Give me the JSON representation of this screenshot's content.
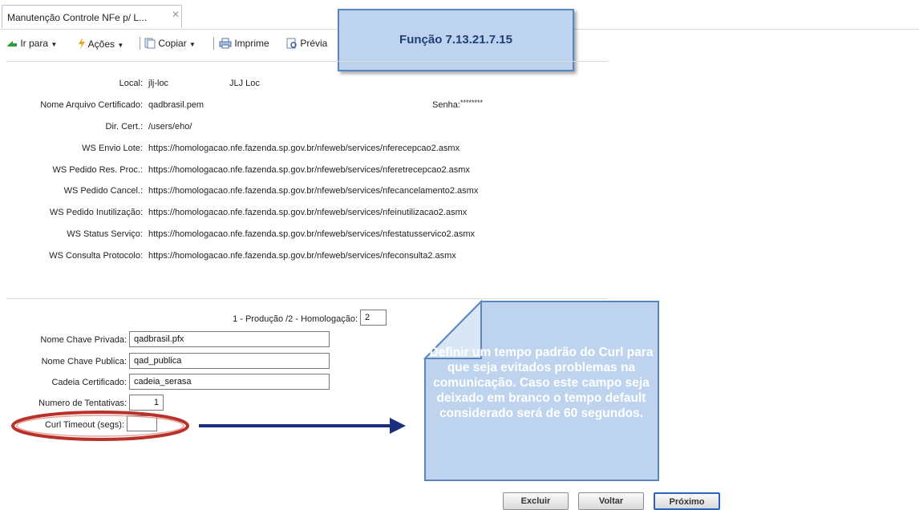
{
  "tab": {
    "title": "Manutenção Controle NFe p/ L...",
    "close": "✕"
  },
  "toolbar": {
    "ir_para": "Ir para",
    "acoes": "Ações",
    "copiar": "Copiar",
    "imprime": "Imprime",
    "previa": "Prévia"
  },
  "callout_function": "Função 7.13.21.7.15",
  "form": {
    "local_label": "Local:",
    "local_value": "jlj-loc",
    "local_desc": "JLJ Loc",
    "cert_label": "Nome Arquivo Certificado:",
    "cert_value": "qadbrasil.pem",
    "senha_label": "Senha:",
    "senha_value": "********",
    "dir_label": "Dir. Cert.:",
    "dir_value": "/users/eho/",
    "ws_envio_label": "WS Envio Lote:",
    "ws_envio_value": "https://homologacao.nfe.fazenda.sp.gov.br/nfeweb/services/nferecepcao2.asmx",
    "ws_pedido_res_label": "WS Pedido Res. Proc.:",
    "ws_pedido_res_value": "https://homologacao.nfe.fazenda.sp.gov.br/nfeweb/services/nferetrecepcao2.asmx",
    "ws_cancel_label": "WS Pedido Cancel.:",
    "ws_cancel_value": "https://homologacao.nfe.fazenda.sp.gov.br/nfeweb/services/nfecancelamento2.asmx",
    "ws_inut_label": "WS Pedido Inutilização:",
    "ws_inut_value": "https://homologacao.nfe.fazenda.sp.gov.br/nfeweb/services/nfeinutilizacao2.asmx",
    "ws_status_label": "WS Status Serviço:",
    "ws_status_value": "https://homologacao.nfe.fazenda.sp.gov.br/nfeweb/services/nfestatusservico2.asmx",
    "ws_consulta_label": "WS Consulta Protocolo:",
    "ws_consulta_value": "https://homologacao.nfe.fazenda.sp.gov.br/nfeweb/services/nfeconsulta2.asmx"
  },
  "form2": {
    "ambiente_label": "1 - Produção /2 - Homologação:",
    "ambiente_value": "2",
    "chave_privada_label": "Nome Chave Privada:",
    "chave_privada_value": "qadbrasil.pfx",
    "chave_publica_label": "Nome Chave Publica:",
    "chave_publica_value": "qad_publica",
    "cadeia_label": "Cadeia Certificado:",
    "cadeia_value": "cadeia_serasa",
    "tentativas_label": "Numero de Tentativas:",
    "tentativas_value": "1",
    "curl_label": "Curl Timeout (segs):",
    "curl_value": ""
  },
  "callout_text": "Definir um tempo padrão do Curl para que seja evitados problemas na comunicação. Caso este campo seja deixado em branco o tempo default considerado será de 60 segundos.",
  "buttons": {
    "excluir": "Excluir",
    "voltar": "Voltar",
    "proximo": "Próximo"
  },
  "colors": {
    "callout_fill": "#bdd3ee",
    "callout_border": "#5a86c0",
    "arrow": "#1c2f7e",
    "highlight_ring": "#c0392b"
  }
}
